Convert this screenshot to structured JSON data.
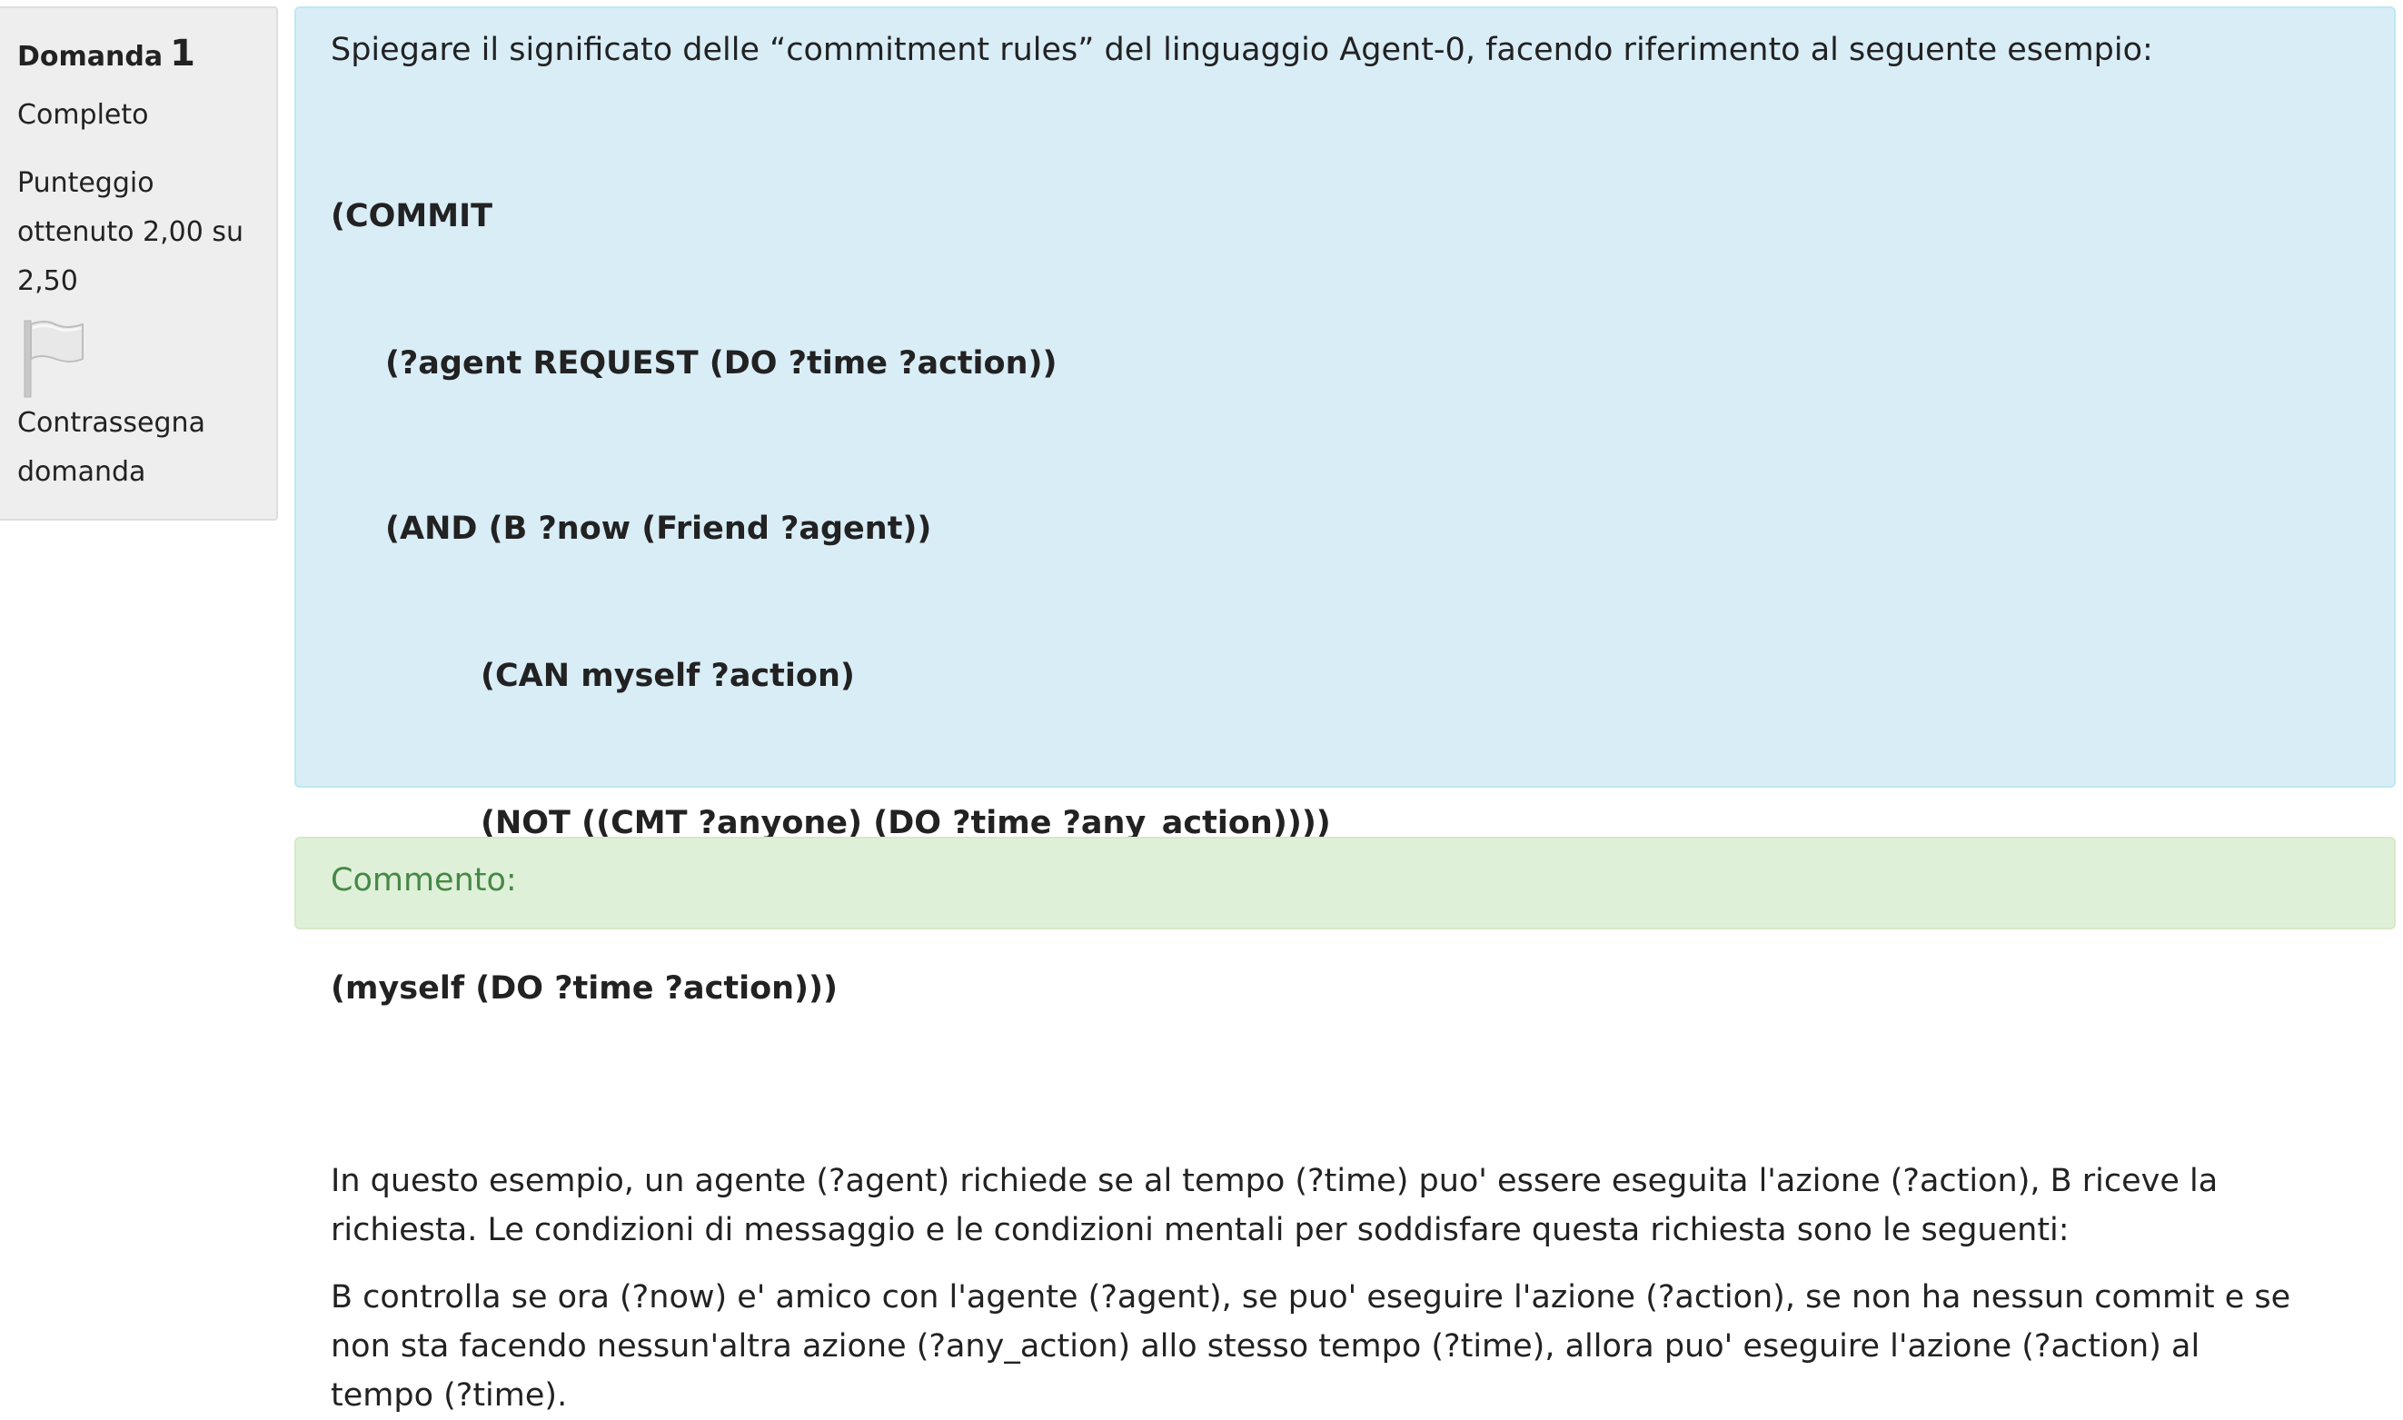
{
  "info": {
    "title_label": "Domanda",
    "question_number": "1",
    "state": "Completo",
    "grade": "Punteggio ottenuto 2,00 su 2,50",
    "flag_label": "Contrassegna domanda",
    "flag_icon": "flag-icon"
  },
  "question": {
    "text": "Spiegare il significato delle “commitment rules” del linguaggio Agent-0, facendo riferimento al seguente esempio:",
    "code_lines": [
      "(COMMIT",
      "(?agent REQUEST (DO ?time ?action))",
      "(AND (B ?now (Friend ?agent))",
      "(CAN myself ?action)",
      "(NOT ((CMT ?anyone) (DO ?time ?any_action))))",
      "(myself (DO ?time ?action)))"
    ]
  },
  "answer": {
    "paragraphs": [
      "In questo esempio, un agente (?agent)  richiede se al tempo (?time) puo' essere eseguita l'azione (?action), B riceve la richiesta. Le condizioni di messaggio e le condizioni mentali per soddisfare questa richiesta sono le seguenti:",
      "B controlla se ora (?now) e' amico con l'agente (?agent), se puo' eseguire l'azione (?action), se non ha nessun commit e se non sta facendo nessun'altra azione (?any_action) allo stesso tempo (?time), allora puo' eseguire l'azione (?action) al tempo (?time)."
    ]
  },
  "comment": {
    "label": "Commento:"
  },
  "colors": {
    "question_bg": "#d9edf7",
    "comment_bg": "#dff0d8",
    "comment_text": "#468847",
    "info_bg": "#eeeeee"
  }
}
